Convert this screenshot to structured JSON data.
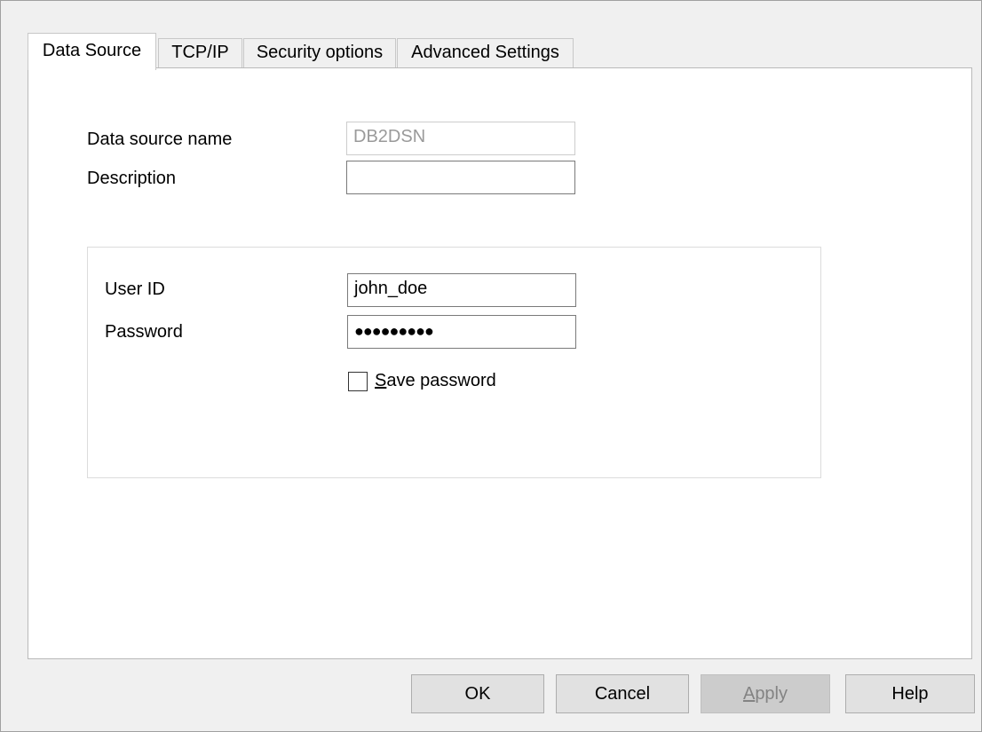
{
  "tabs": [
    {
      "label": "Data Source",
      "active": true
    },
    {
      "label": "TCP/IP",
      "active": false
    },
    {
      "label": "Security options",
      "active": false
    },
    {
      "label": "Advanced Settings",
      "active": false
    }
  ],
  "data_source": {
    "name_label": "Data source name",
    "name_value": "DB2DSN",
    "description_label": "Description",
    "description_value": ""
  },
  "credentials": {
    "user_id_label": "User ID",
    "user_id_value": "john_doe",
    "password_label": "Password",
    "password_value": "●●●●●●●●●",
    "save_password_mnemonic": "S",
    "save_password_rest": "ave password",
    "save_password_checked": false
  },
  "buttons": {
    "ok": "OK",
    "cancel": "Cancel",
    "apply_mnemonic": "A",
    "apply_rest": "pply",
    "help": "Help"
  }
}
